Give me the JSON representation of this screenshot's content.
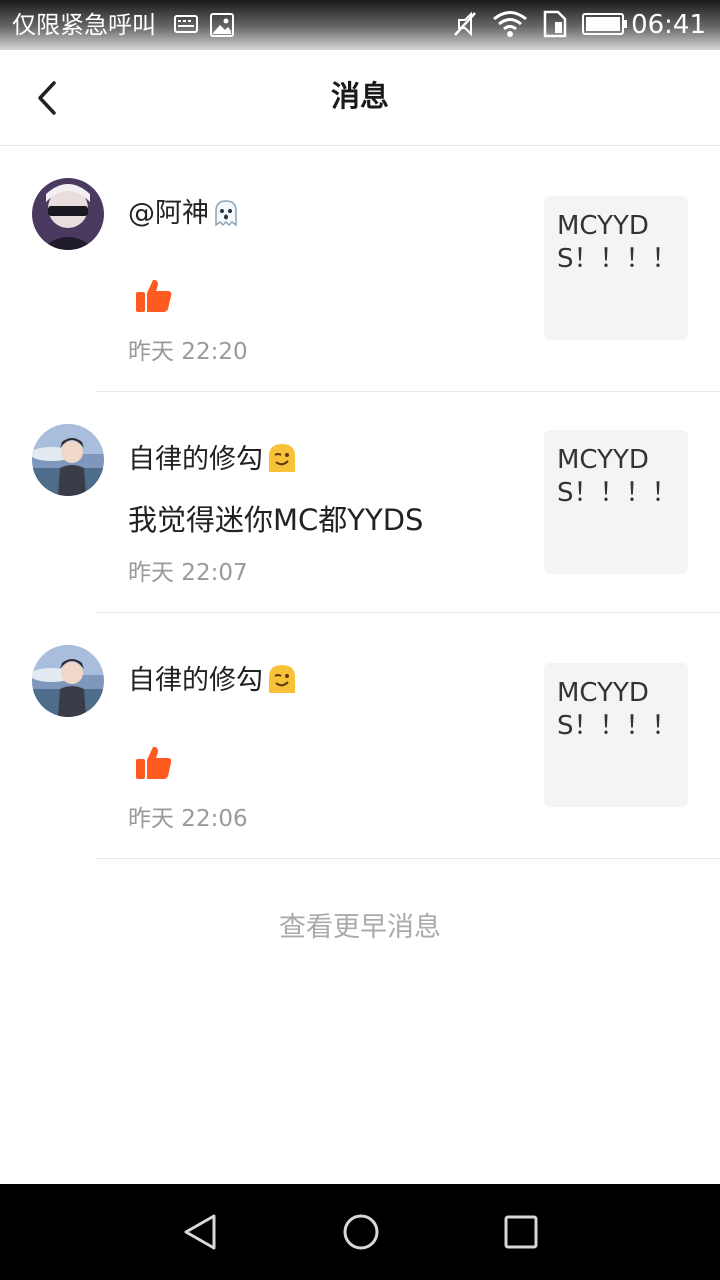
{
  "status_bar": {
    "carrier": "仅限紧急呼叫",
    "time": "06:41",
    "left_icons": [
      "keyboard-icon",
      "image-icon"
    ],
    "right_icons": [
      "mute-icon",
      "wifi-icon",
      "sim-icon",
      "battery-icon"
    ]
  },
  "header": {
    "title": "消息",
    "back_icon": "back-arrow-icon"
  },
  "messages": [
    {
      "username": "@阿神",
      "name_emoji": "ghost-emoji-icon",
      "content_type": "like",
      "content_icon": "thumbs-up-icon",
      "content": "",
      "time": "昨天 22:20",
      "post_preview": "MCYYDS！！！！"
    },
    {
      "username": "自律的修勾",
      "name_emoji": "winking-emoji-icon",
      "content_type": "comment",
      "content": "我觉得迷你MC都YYDS",
      "time": "昨天 22:07",
      "post_preview": "MCYYDS！！！！"
    },
    {
      "username": "自律的修勾",
      "name_emoji": "winking-emoji-icon",
      "content_type": "like",
      "content_icon": "thumbs-up-icon",
      "content": "",
      "time": "昨天 22:06",
      "post_preview": "MCYYDS！！！！"
    }
  ],
  "footer": {
    "load_earlier": "查看更早消息"
  },
  "system_nav": {
    "buttons": [
      "back-triangle-icon",
      "home-circle-icon",
      "recents-square-icon"
    ]
  },
  "colors": {
    "like_orange": "#ff5a1f",
    "title_text": "#1a1a1a",
    "secondary_text": "#9a9a9a",
    "thumb_bg": "#f4f4f4",
    "emoji_yellow": "#f7c23a"
  }
}
